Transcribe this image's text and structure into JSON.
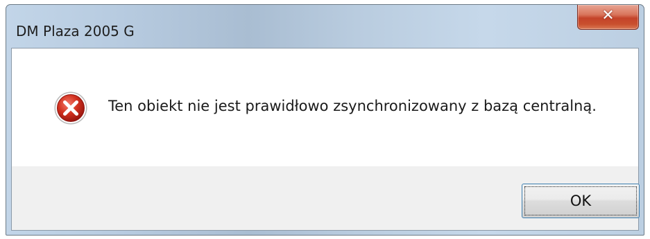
{
  "window": {
    "title": "DM Plaza 2005 G",
    "close_icon": "close-icon"
  },
  "dialog": {
    "icon": "error-icon",
    "message": "Ten obiekt nie jest prawidłowo zsynchronizowany z bazą centralną."
  },
  "buttons": {
    "ok_label": "OK"
  },
  "colors": {
    "error_red": "#c8251c",
    "close_button_red": "#c4432a",
    "button_focus_border": "#3c7fb1",
    "footer_background": "#f0f0f0"
  }
}
